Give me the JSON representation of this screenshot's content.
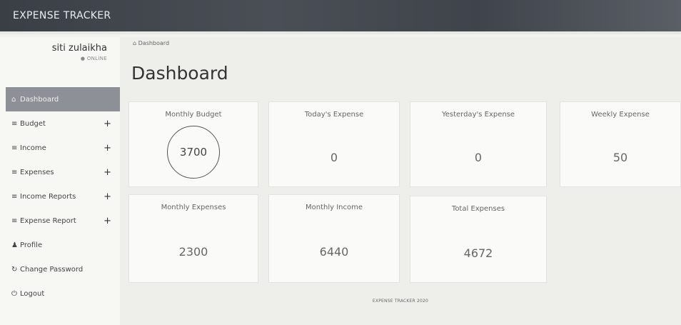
{
  "app": {
    "brand": "EXPENSE TRACKER"
  },
  "user": {
    "name": "siti zulaikha",
    "status": "ONLINE"
  },
  "sidebar": {
    "items": [
      {
        "label": "Dashboard",
        "icon": "home-icon",
        "glyph": "⌂",
        "expandable": false,
        "active": true
      },
      {
        "label": "Budget",
        "icon": "list-icon",
        "glyph": "≡",
        "expandable": true,
        "active": false
      },
      {
        "label": "Income",
        "icon": "list-icon",
        "glyph": "≡",
        "expandable": true,
        "active": false
      },
      {
        "label": "Expenses",
        "icon": "list-icon",
        "glyph": "≡",
        "expandable": true,
        "active": false
      },
      {
        "label": "Income Reports",
        "icon": "list-icon",
        "glyph": "≡",
        "expandable": true,
        "active": false
      },
      {
        "label": "Expense Report",
        "icon": "list-icon",
        "glyph": "≡",
        "expandable": true,
        "active": false
      },
      {
        "label": "Profile",
        "icon": "user-icon",
        "glyph": "♟",
        "expandable": false,
        "active": false
      },
      {
        "label": "Change Password",
        "icon": "refresh-icon",
        "glyph": "↻",
        "expandable": false,
        "active": false
      },
      {
        "label": "Logout",
        "icon": "power-icon",
        "glyph": "⏻",
        "expandable": false,
        "active": false
      }
    ],
    "expand_glyph": "+"
  },
  "breadcrumb": {
    "home_glyph": "⌂",
    "label": "Dashboard"
  },
  "page": {
    "title": "Dashboard"
  },
  "cards": {
    "monthly_budget": {
      "title": "Monthly Budget",
      "value": "3700"
    },
    "todays_expense": {
      "title": "Today's Expense",
      "value": "0"
    },
    "yesterdays_expense": {
      "title": "Yesterday's Expense",
      "value": "0"
    },
    "weekly_expense": {
      "title": "Weekly Expense",
      "value": "50"
    },
    "monthly_expenses": {
      "title": "Monthly Expenses",
      "value": "2300"
    },
    "monthly_income": {
      "title": "Monthly Income",
      "value": "6440"
    },
    "total_expenses": {
      "title": "Total Expenses",
      "value": "4672"
    }
  },
  "footer": {
    "text": "EXPENSE TRACKER 2020"
  },
  "colors": {
    "topbar": "#3f444b",
    "active_menu": "#8d9096",
    "background": "#eeeeea"
  }
}
